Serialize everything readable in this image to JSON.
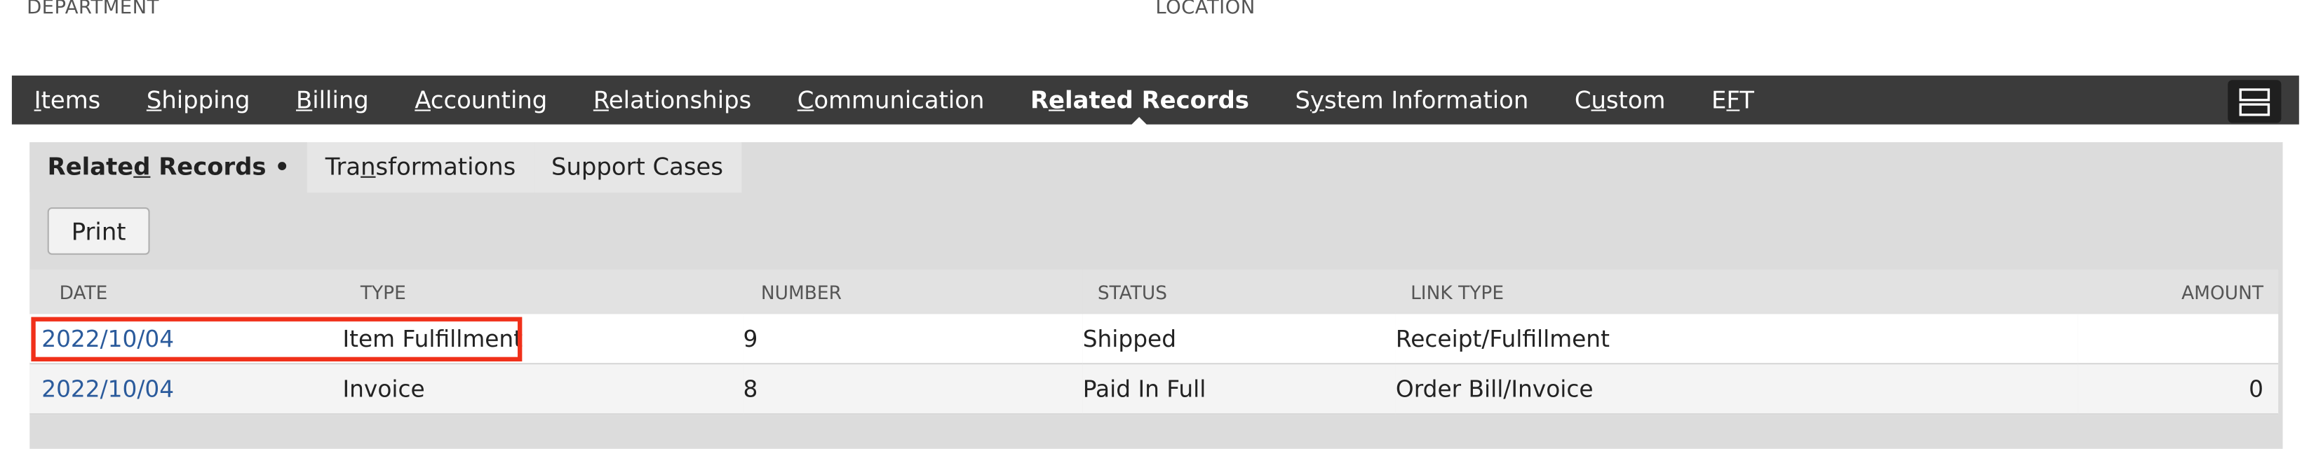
{
  "header_fields": {
    "department_label": "DEPARTMENT",
    "location_label": "LOCATION"
  },
  "main_tabs": [
    {
      "pre": "",
      "acc": "I",
      "post": "tems"
    },
    {
      "pre": "",
      "acc": "S",
      "post": "hipping"
    },
    {
      "pre": "",
      "acc": "B",
      "post": "illing"
    },
    {
      "pre": "",
      "acc": "A",
      "post": "ccounting"
    },
    {
      "pre": "",
      "acc": "R",
      "post": "elationships"
    },
    {
      "pre": "",
      "acc": "C",
      "post": "ommunication"
    },
    {
      "pre": "R",
      "acc": "e",
      "post": "lated Records"
    },
    {
      "pre": "S",
      "acc": "y",
      "post": "stem Information"
    },
    {
      "pre": "C",
      "acc": "u",
      "post": "stom"
    },
    {
      "pre": "E",
      "acc": "F",
      "post": "T"
    }
  ],
  "active_main_tab": "Related Records",
  "layout_toggle_icon": "layout-toggle-icon",
  "sub_tabs": [
    {
      "pre": "Relate",
      "acc": "d",
      "post": " Records •"
    },
    {
      "pre": "Tra",
      "acc": "n",
      "post": "sformations"
    },
    {
      "pre": "Support Cases",
      "acc": "",
      "post": ""
    }
  ],
  "print_label": "Print",
  "table": {
    "headers": [
      "DATE",
      "TYPE",
      "NUMBER",
      "STATUS",
      "LINK TYPE",
      "AMOUNT"
    ],
    "rows": [
      {
        "date": "2022/10/04",
        "type": "Item Fulfillment",
        "number": "9",
        "status": "Shipped",
        "link_type": "Receipt/Fulfillment",
        "amount": ""
      },
      {
        "date": "2022/10/04",
        "type": "Invoice",
        "number": "8",
        "status": "Paid In Full",
        "link_type": "Order Bill/Invoice",
        "amount": "0"
      }
    ]
  },
  "colors": {
    "tab_bar": "#3b3b3b",
    "link": "#2b5b9c",
    "highlight": "#f0301a"
  }
}
